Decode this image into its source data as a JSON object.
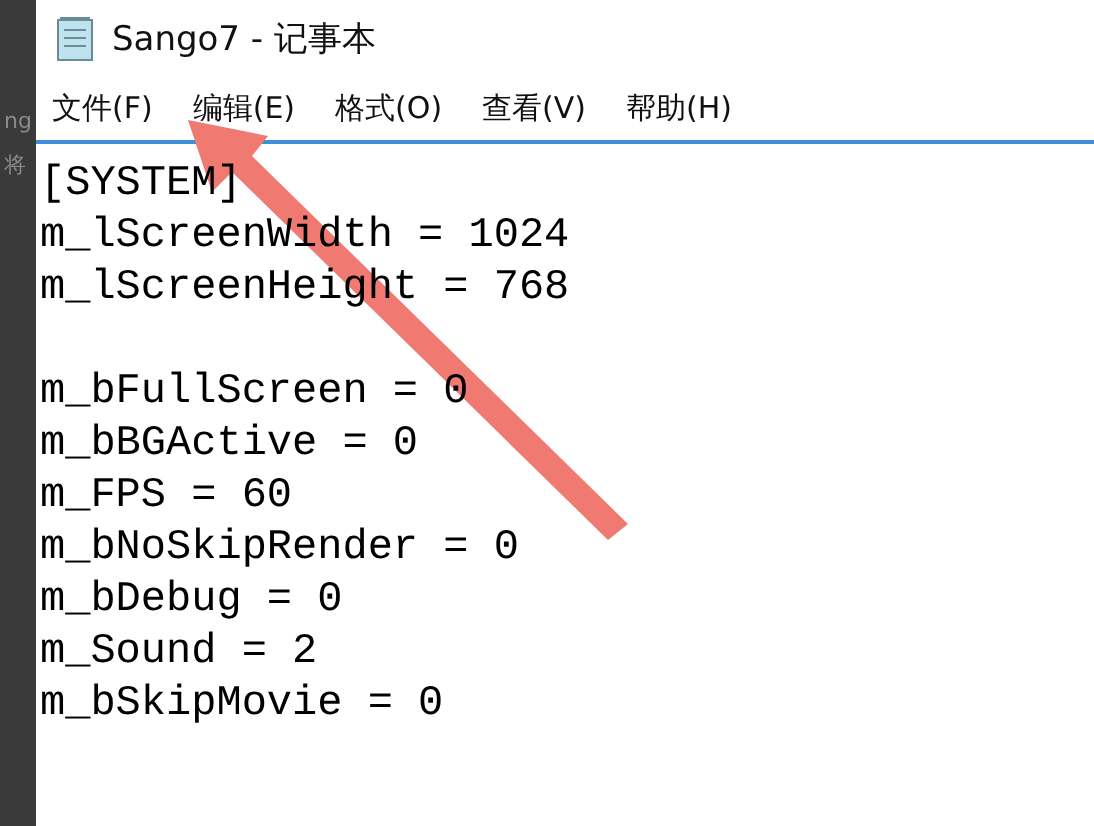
{
  "side_strip": {
    "texts": [
      "ng",
      "将"
    ]
  },
  "window": {
    "title": "Sango7 - 记事本"
  },
  "menu": [
    "文件(F)",
    "编辑(E)",
    "格式(O)",
    "查看(V)",
    "帮助(H)"
  ],
  "editor": {
    "lines": [
      {
        "kind": "text",
        "text": "[SYSTEM]"
      },
      {
        "kind": "text",
        "text": "m_lScreenWidth = 1024"
      },
      {
        "kind": "text",
        "text": "m_lScreenHeight = 768"
      },
      {
        "kind": "blank"
      },
      {
        "kind": "text",
        "text": "m_bFullScreen = 0"
      },
      {
        "kind": "text",
        "text": "m_bBGActive = 0"
      },
      {
        "kind": "text",
        "text": "m_FPS = 60"
      },
      {
        "kind": "text",
        "text": "m_bNoSkipRender = 0"
      },
      {
        "kind": "text",
        "text": "m_bDebug = 0"
      },
      {
        "kind": "text",
        "text": "m_Sound = 2"
      },
      {
        "kind": "text",
        "text": "m_bSkipMovie = 0"
      }
    ]
  }
}
